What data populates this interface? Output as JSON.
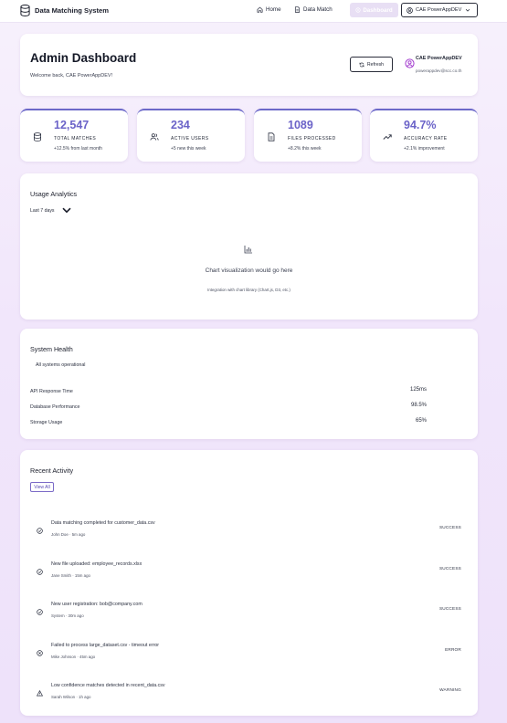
{
  "app": {
    "title": "Data Matching System",
    "nav": {
      "home": "Home",
      "data_match": "Data Match",
      "dashboard": "Dashboard"
    },
    "user_menu": "CAE PowerAppDEV"
  },
  "header": {
    "title": "Admin Dashboard",
    "welcome": "Welcome back, CAE PowerAppDEV!",
    "refresh_label": "Refresh",
    "profile_name": "CAE PowerAppDEV",
    "profile_email": "powerappdev@scc.co.th"
  },
  "stats": [
    {
      "value": "12,547",
      "label": "TOTAL MATCHES",
      "change": "+12.5% from last month",
      "icon": "database-icon"
    },
    {
      "value": "234",
      "label": "ACTIVE USERS",
      "change": "+5 new this week",
      "icon": "users-icon"
    },
    {
      "value": "1089",
      "label": "FILES PROCESSED",
      "change": "+8.2% this week",
      "icon": "file-icon"
    },
    {
      "value": "94.7%",
      "label": "ACCURACY RATE",
      "change": "+2.1% improvement",
      "icon": "trending-up-icon"
    }
  ],
  "analytics": {
    "title": "Usage Analytics",
    "range": "Last 7 days",
    "placeholder": "Chart visualization would go here",
    "subtext": "Integration with chart library (Chart.js, D3, etc.)"
  },
  "health": {
    "title": "System Health",
    "status": "All systems operational",
    "metrics": [
      {
        "name": "API Response Time",
        "value": "125ms"
      },
      {
        "name": "Database Performance",
        "value": "98.5%"
      },
      {
        "name": "Storage Usage",
        "value": "65%"
      }
    ]
  },
  "activity": {
    "title": "Recent Activity",
    "view_all": "View All",
    "items": [
      {
        "message": "Data matching completed for customer_data.csv",
        "user": "John Doe",
        "time": "5m ago",
        "status": "SUCCESS",
        "icon": "check-circle-icon"
      },
      {
        "message": "New file uploaded: employee_records.xlsx",
        "user": "Jane Smith",
        "time": "15m ago",
        "status": "SUCCESS",
        "icon": "check-circle-icon"
      },
      {
        "message": "New user registration: bob@company.com",
        "user": "System",
        "time": "30m ago",
        "status": "SUCCESS",
        "icon": "check-circle-icon"
      },
      {
        "message": "Failed to process large_dataset.csv - timeout error",
        "user": "Mike Johnson",
        "time": "45m ago",
        "status": "ERROR",
        "icon": "x-circle-icon"
      },
      {
        "message": "Low confidence matches detected in recent_data.csv",
        "user": "Sarah Wilson",
        "time": "1h ago",
        "status": "WARNING",
        "icon": "warning-triangle-icon"
      }
    ]
  },
  "colors": {
    "accent": "#6b63c8",
    "background": "#f1e6fb"
  }
}
